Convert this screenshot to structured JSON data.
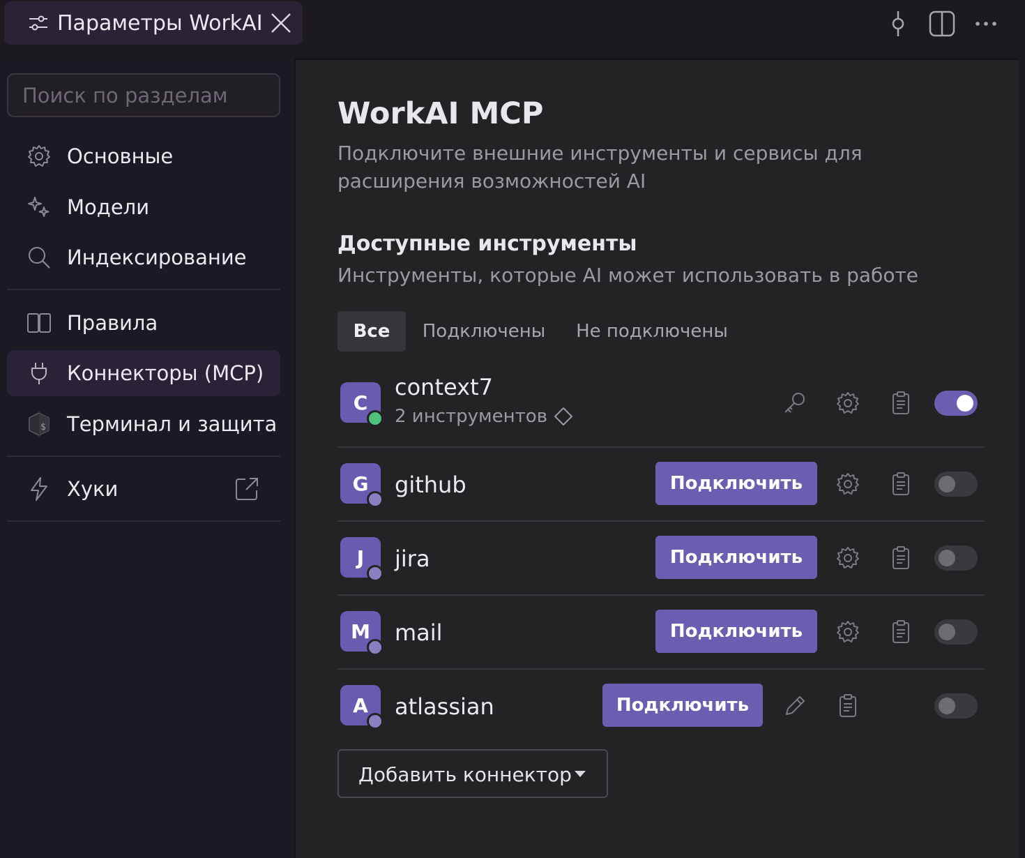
{
  "window": {
    "tab_title": "Параметры WorkAI"
  },
  "sidebar": {
    "search_placeholder": "Поиск по разделам",
    "items": [
      {
        "label": "Основные",
        "icon": "gear-icon"
      },
      {
        "label": "Модели",
        "icon": "sparkles-icon"
      },
      {
        "label": "Индексирование",
        "icon": "search-icon"
      },
      {
        "label": "Правила",
        "icon": "book-icon"
      },
      {
        "label": "Коннекторы (MCP)",
        "icon": "plug-icon",
        "active": true
      },
      {
        "label": "Терминал и защита",
        "icon": "shield-terminal-icon"
      },
      {
        "label": "Хуки",
        "icon": "lightning-icon",
        "external": true
      }
    ]
  },
  "main": {
    "title": "WorkAI MCP",
    "description": "Подключите внешние инструменты и сервисы для расширения возможностей AI",
    "section_title": "Доступные инструменты",
    "section_desc": "Инструменты, которые AI может использовать в работе",
    "filters": [
      "Все",
      "Подключены",
      "Не подключены"
    ],
    "active_filter": "Все",
    "connect_label": "Подключить",
    "connectors": [
      {
        "letter": "C",
        "name": "context7",
        "meta": "2 инструментов",
        "status": "connected",
        "enabled": true
      },
      {
        "letter": "G",
        "name": "github",
        "status": "disconnected",
        "enabled": false
      },
      {
        "letter": "J",
        "name": "jira",
        "status": "disconnected",
        "enabled": false
      },
      {
        "letter": "M",
        "name": "mail",
        "status": "disconnected",
        "enabled": false
      },
      {
        "letter": "A",
        "name": "atlassian",
        "status": "disconnected",
        "enabled": false
      }
    ],
    "add_connector_label": "Добавить коннектор"
  },
  "colors": {
    "accent": "#6d5db0",
    "status_connected": "#4ec27a",
    "status_disconnected": "#8a7fc0"
  }
}
